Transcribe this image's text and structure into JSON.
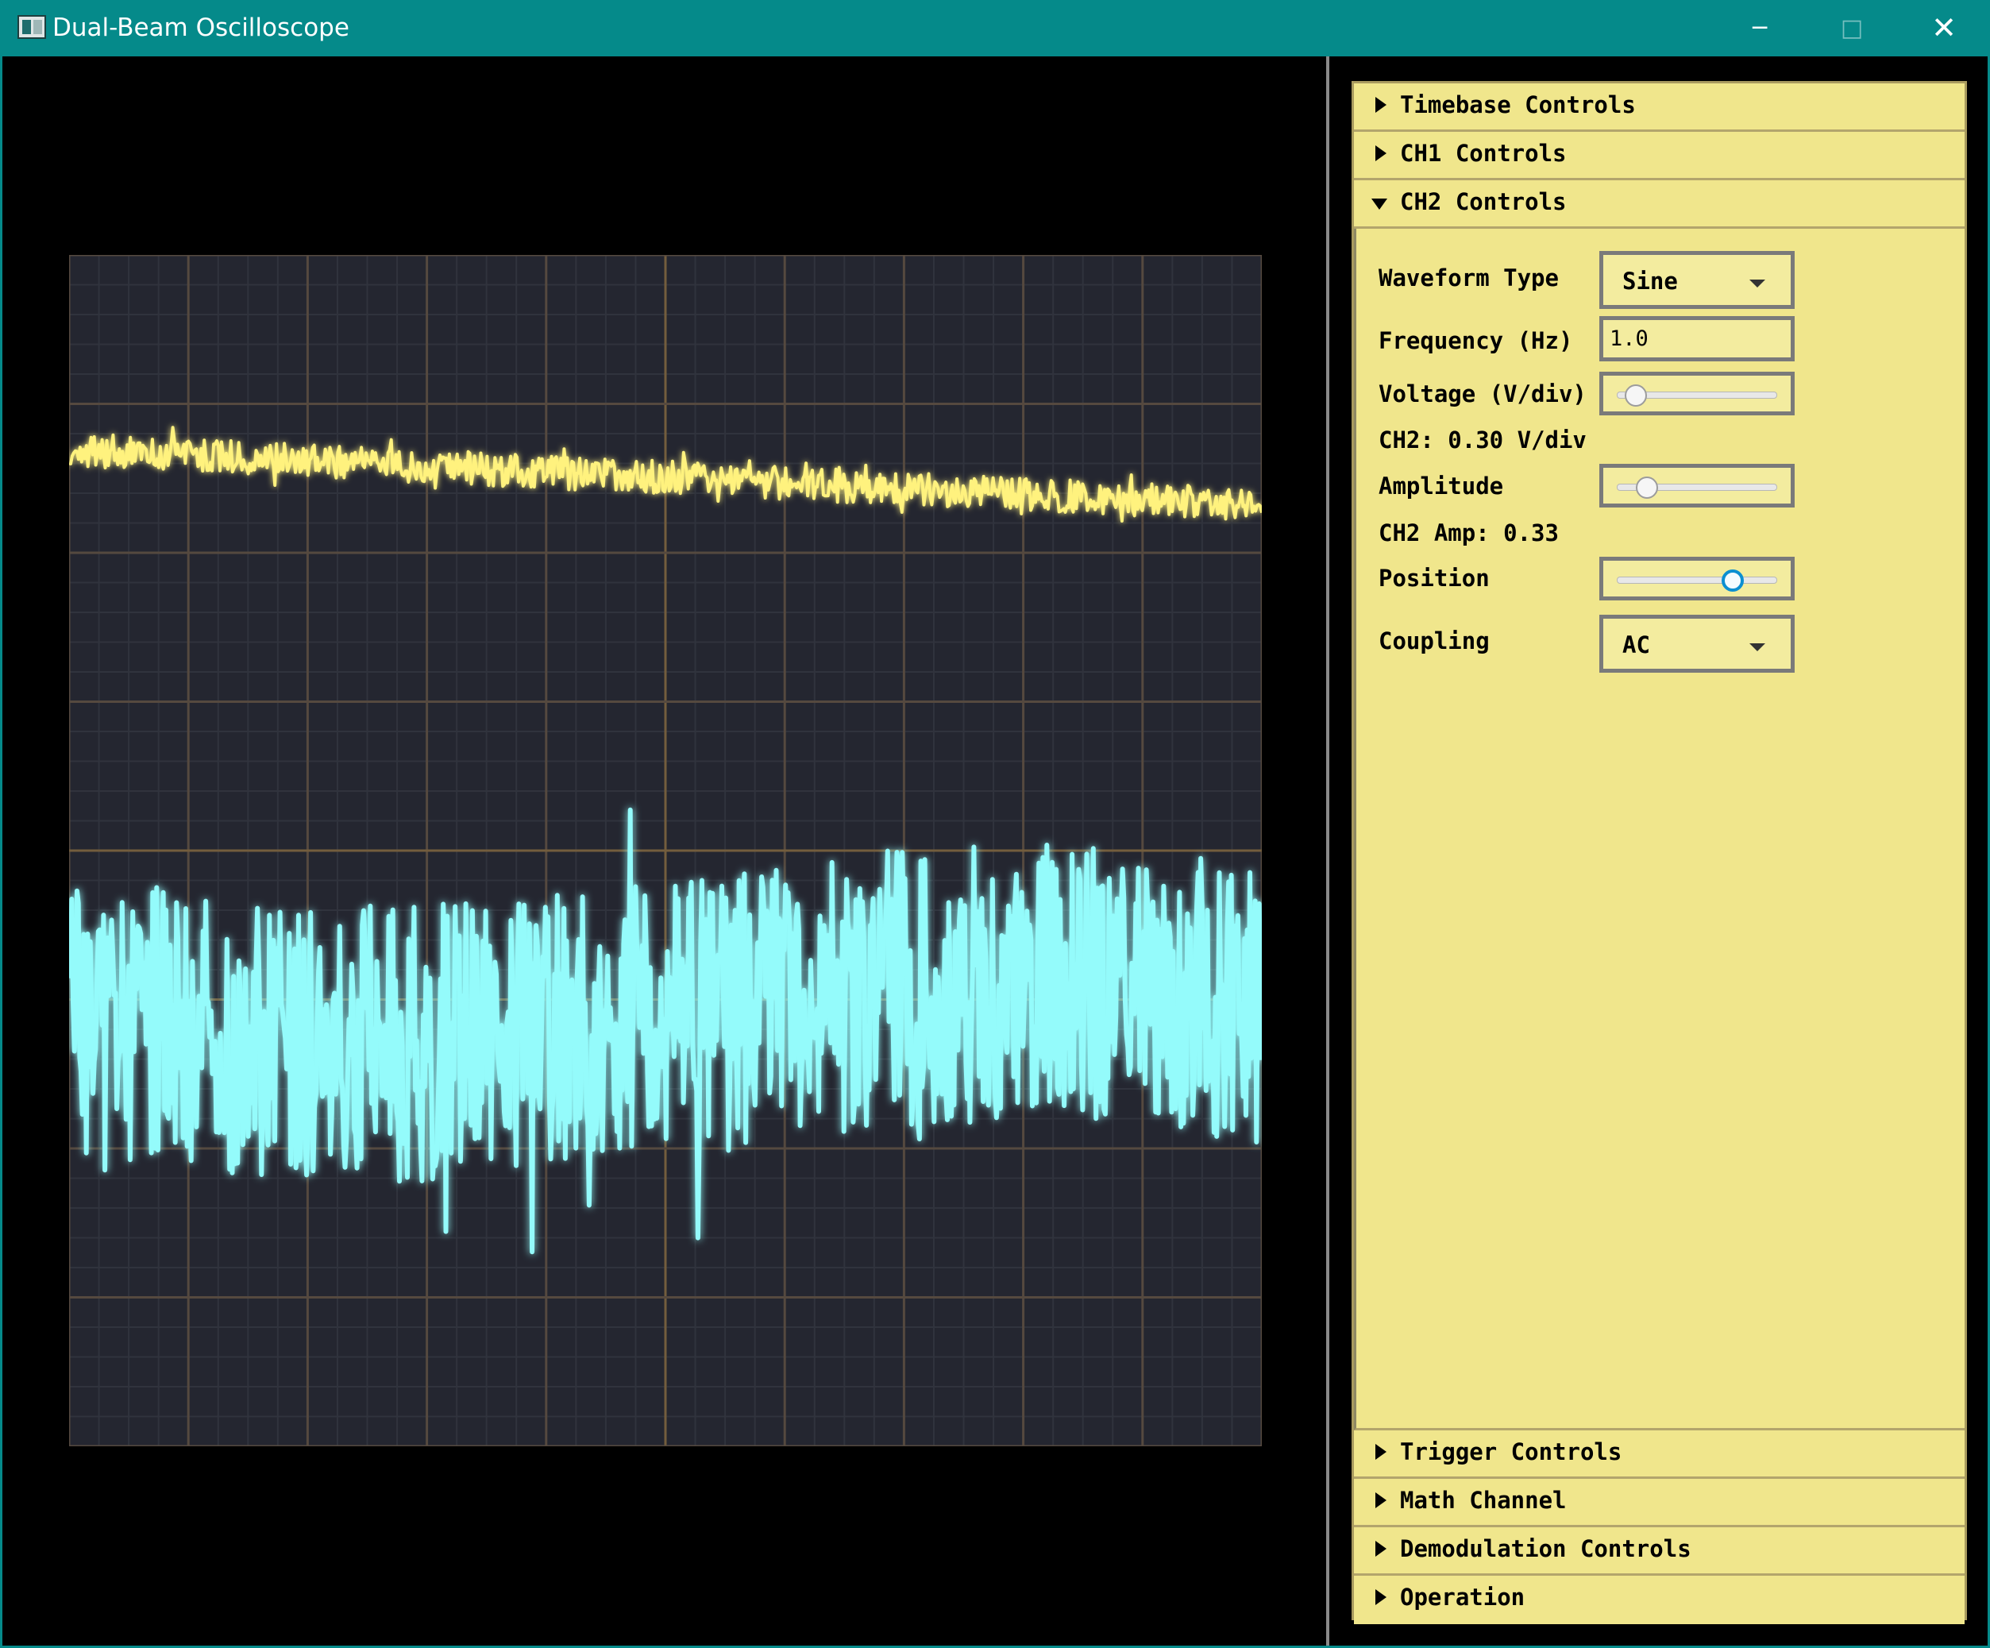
{
  "window": {
    "title": "Dual-Beam Oscilloscope",
    "controls": {
      "minimize_icon": "─",
      "maximize_icon": "□",
      "close_icon": "✕"
    }
  },
  "colors": {
    "titlebar": "#058a8a",
    "panel": "#f0e68c",
    "ch1_trace": "#fff27e",
    "ch2_trace": "#94fbfb",
    "scope_screen": "#242630"
  },
  "panel": {
    "sections": {
      "timebase": "Timebase Controls",
      "ch1": "CH1 Controls",
      "ch2": "CH2 Controls",
      "trigger": "Trigger Controls",
      "math": "Math Channel",
      "demodulation": "Demodulation Controls",
      "operation": "Operation"
    },
    "ch2": {
      "waveform_type_label": "Waveform Type",
      "waveform_type_value": "Sine",
      "frequency_label": "Frequency (Hz)",
      "frequency_value": "1.0",
      "voltage_label": "Voltage (V/div)",
      "voltage_slider_fraction": 0.06,
      "voltage_readout": "CH2: 0.30 V/div",
      "amplitude_label": "Amplitude",
      "amplitude_slider_fraction": 0.14,
      "amplitude_readout": "CH2 Amp: 0.33",
      "position_label": "Position",
      "position_slider_fraction": 0.76,
      "coupling_label": "Coupling",
      "coupling_value": "AC"
    }
  },
  "icons": {
    "collapsed": "play-right-icon",
    "expanded": "triangle-down-icon",
    "dropdown": "chevron-down-icon"
  }
}
